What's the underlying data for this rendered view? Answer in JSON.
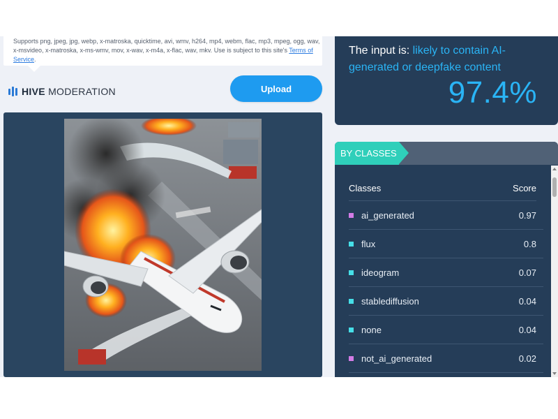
{
  "info": {
    "text": "Supports png, jpeg, jpg, webp, x-matroska, quicktime, avi, wmv, h264, mp4, webm, flac, mp3, mpeg, ogg, wav, x-msvideo, x-matroska, x-ms-wmv, mov, x-wav, x-m4a, x-flac, wav, mkv. Use is subject to this site's ",
    "tos_link": "Terms of Service",
    "tos_suffix": "."
  },
  "logo": {
    "bold": "HIVE",
    "light": "MODERATION",
    "icon": "hive-logo-bars"
  },
  "upload": {
    "label": "Upload"
  },
  "result": {
    "prefix": "The input is: ",
    "verdict": "likely to contain AI-generated or deepfake content",
    "percent": "97.4%"
  },
  "classes": {
    "tab_label": "BY CLASSES",
    "col_class": "Classes",
    "col_score": "Score",
    "rows": [
      {
        "name": "ai_generated",
        "score": "0.97",
        "color": "#d37ce6"
      },
      {
        "name": "flux",
        "score": "0.8",
        "color": "#46dfe8"
      },
      {
        "name": "ideogram",
        "score": "0.07",
        "color": "#46dfe8"
      },
      {
        "name": "stablediffusion",
        "score": "0.04",
        "color": "#46dfe8"
      },
      {
        "name": "none",
        "score": "0.04",
        "color": "#46dfe8"
      },
      {
        "name": "not_ai_generated",
        "score": "0.02",
        "color": "#d37ce6"
      }
    ]
  },
  "colors": {
    "accent": "#2ab4f5",
    "panel": "#253d58",
    "tab": "#2fcfba",
    "button": "#1e9bf0"
  }
}
